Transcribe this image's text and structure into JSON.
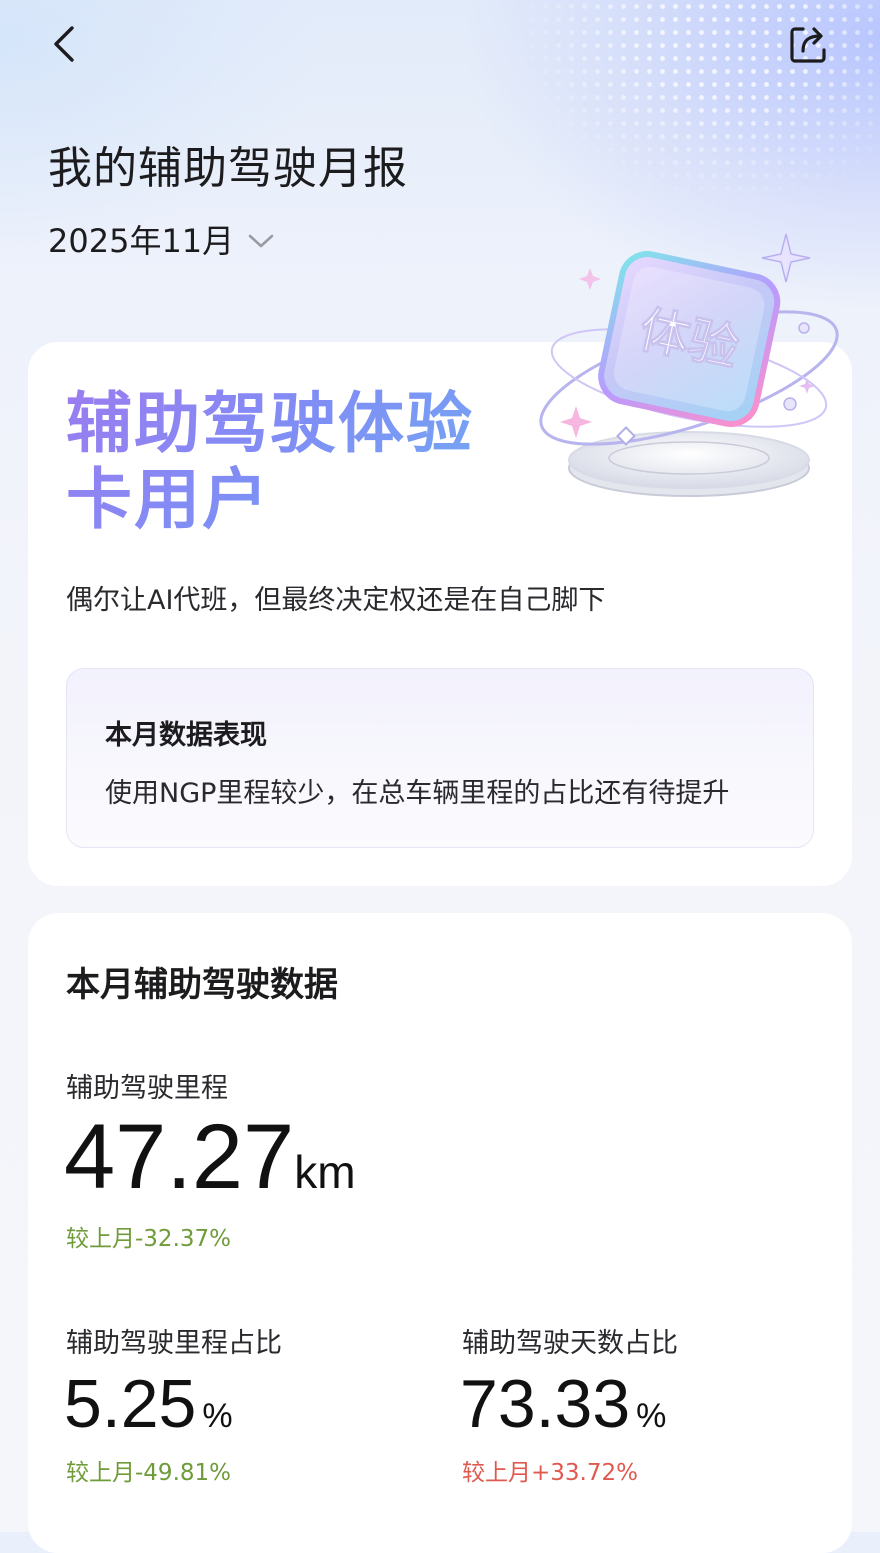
{
  "header": {
    "title": "我的辅助驾驶月报",
    "month": "2025年11月"
  },
  "badge": {
    "emblem_text": "体验",
    "title": "辅助驾驶体验卡用户",
    "description": "偶尔让AI代班，但最终决定权还是在自己脚下"
  },
  "performance": {
    "title": "本月数据表现",
    "text": "使用NGP里程较少，在总车辆里程的占比还有待提升"
  },
  "monthly_data": {
    "title": "本月辅助驾驶数据",
    "mileage": {
      "label": "辅助驾驶里程",
      "value": "47.27",
      "unit": "km",
      "delta": "较上月-32.37%"
    },
    "mileage_ratio": {
      "label": "辅助驾驶里程占比",
      "value": "5.25",
      "unit": "%",
      "delta": "较上月-49.81%"
    },
    "days_ratio": {
      "label": "辅助驾驶天数占比",
      "value": "73.33",
      "unit": "%",
      "delta": "较上月+33.72%"
    }
  },
  "colors": {
    "decrease": "#6f9b3a",
    "increase": "#e0594f",
    "gradient_start": "#9b7cf0",
    "gradient_end": "#6fb1f4"
  },
  "icons": [
    "back-arrow-icon",
    "share-icon",
    "chevron-down-icon"
  ]
}
